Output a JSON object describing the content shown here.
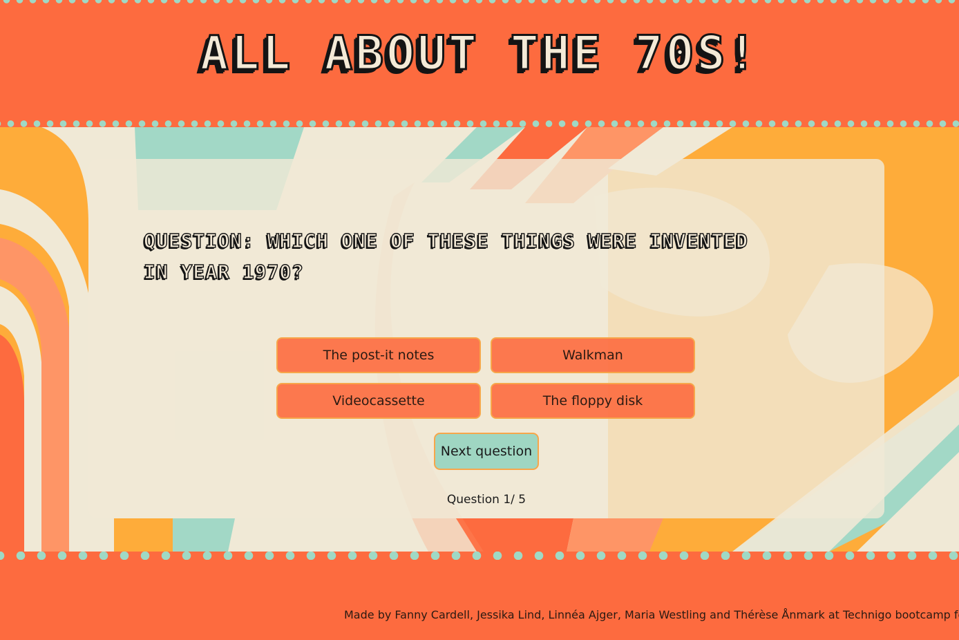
{
  "header": {
    "title": "All about the 70s!"
  },
  "quiz": {
    "question": "Question: Which one of these things were invented in year 1970?",
    "answers": [
      "The post-it notes",
      "Walkman",
      "Videocassette",
      "The floppy disk"
    ],
    "next_label": "Next question",
    "progress": "Question 1/ 5"
  },
  "footer": {
    "credits": "Made by Fanny Cardell, Jessika Lind, Linnéa Ajger, Maria Westling and Thérèse Ånmark at Technigo bootcamp fo"
  },
  "colors": {
    "header_bg": "#fd6b3f",
    "dots": "#9fd9c5",
    "cream": "#f0e9d6",
    "orange": "#fd6b3f",
    "salmon": "#fe9566",
    "yellow": "#feac3a",
    "mint": "#a2d8c6"
  }
}
